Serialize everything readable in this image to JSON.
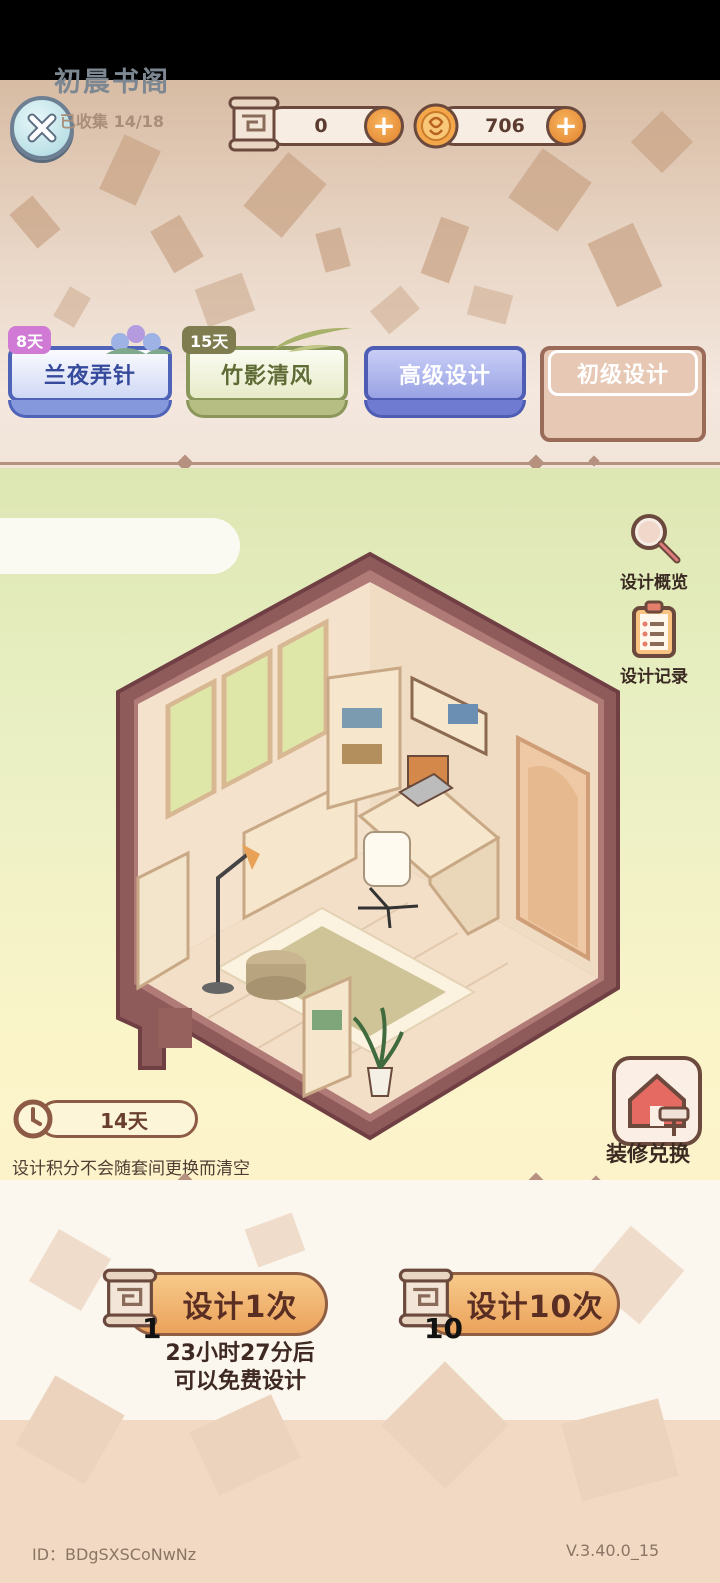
{
  "currencies": {
    "tickets": {
      "value": "0",
      "icon": "scroll-ticket-icon"
    },
    "coins": {
      "value": "706",
      "icon": "coin-icon"
    }
  },
  "tabs": [
    {
      "label": "兰夜弄针",
      "badge": "8天",
      "theme": "#4f63b8"
    },
    {
      "label": "竹影清风",
      "badge": "15天",
      "theme": "#7d8a4c"
    },
    {
      "label": "高级设计",
      "badge": "",
      "theme": "#6a76c6"
    },
    {
      "label": "初级设计",
      "badge": "",
      "theme": "#9a6b58",
      "selected": true
    }
  ],
  "room": {
    "title": "初晨书阁",
    "collected": "已收集 14/18",
    "overview_label": "设计概览",
    "record_label": "设计记录",
    "timer": "14天",
    "notice": "设计积分不会随套间更换而清空",
    "decorate_label": "装修兑换"
  },
  "draw": {
    "single": {
      "label": "设计1次",
      "cost": "1"
    },
    "ten": {
      "label": "设计10次",
      "cost": "10"
    },
    "free_line1": "23小时27分后",
    "free_line2": "可以免费设计"
  },
  "footer": {
    "id": "ID：BDgSXSCoNwNz",
    "version": "V.3.40.0_15"
  },
  "colors": {
    "accent_orange": "#eba35b",
    "brown_outline": "#6b4a3d"
  }
}
